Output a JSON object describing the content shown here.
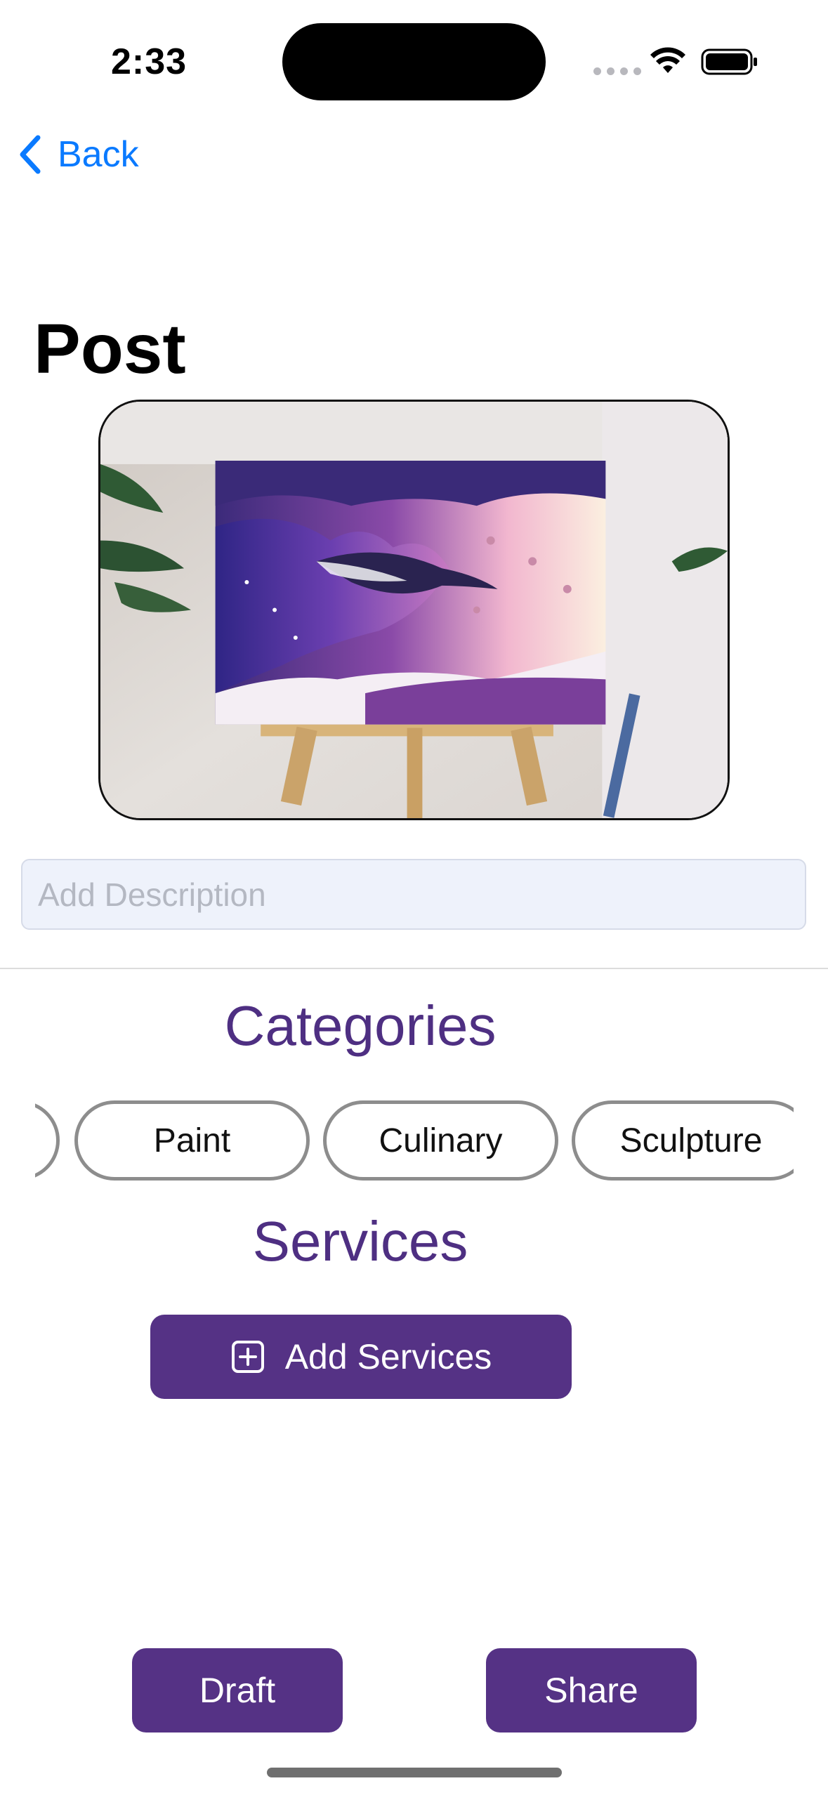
{
  "status_bar": {
    "time": "2:33",
    "icons": [
      "signal-dots-icon",
      "wifi-icon",
      "battery-icon"
    ]
  },
  "nav": {
    "back_label": "Back",
    "back_icon": "chevron-left-icon"
  },
  "page": {
    "title": "Post"
  },
  "post_image": {
    "icon": "artwork-photo"
  },
  "description": {
    "value": "",
    "placeholder": "Add Description"
  },
  "categories": {
    "heading": "Categories",
    "items": [
      "",
      "Paint",
      "Culinary",
      "Sculpture"
    ]
  },
  "services": {
    "heading": "Services",
    "add_label": "Add Services",
    "add_icon": "plus-square-icon"
  },
  "actions": {
    "draft_label": "Draft",
    "share_label": "Share"
  },
  "colors": {
    "accent": "#553285",
    "heading": "#4e2f82",
    "link": "#0a7aff",
    "chip_border": "#8d8d8d",
    "input_bg": "#eef2fb"
  }
}
